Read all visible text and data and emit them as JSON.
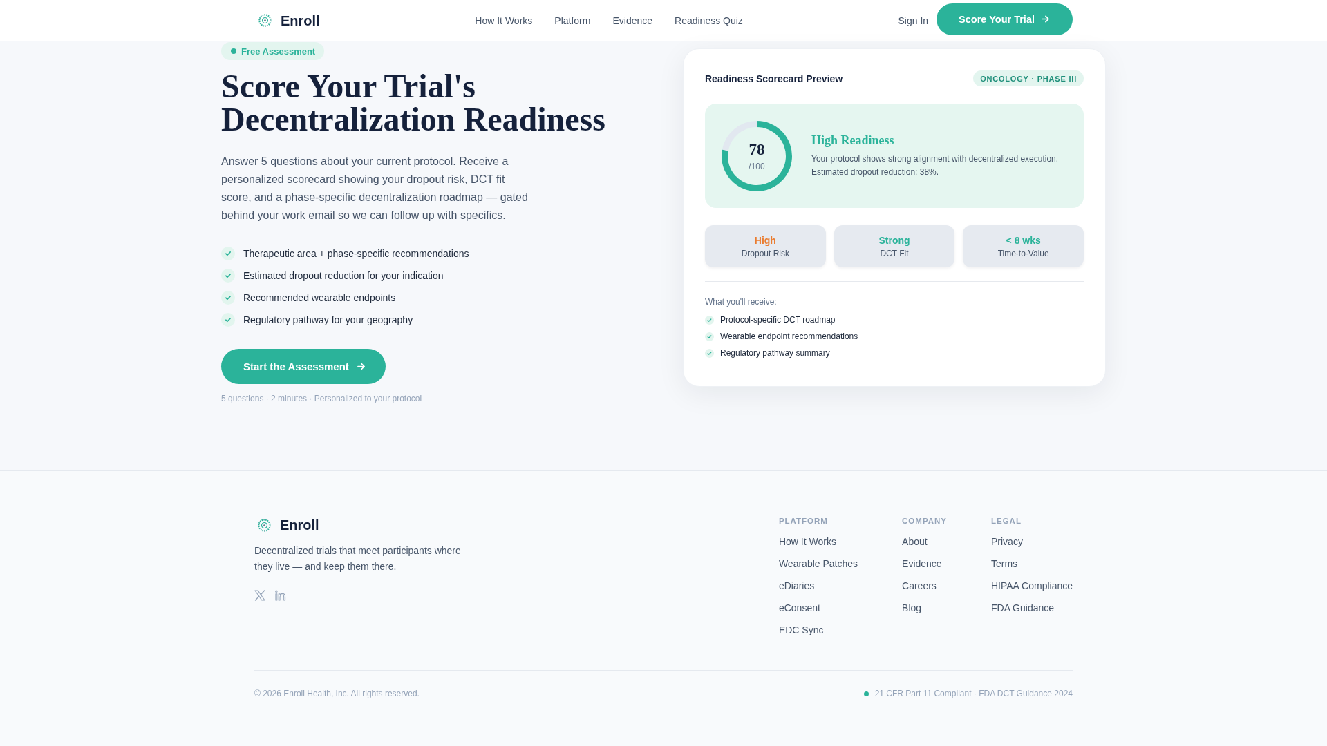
{
  "header": {
    "brand": "Enroll",
    "nav": [
      "How It Works",
      "Platform",
      "Evidence",
      "Readiness Quiz"
    ],
    "sign_in": "Sign In",
    "cta": "Score Your Trial"
  },
  "hero": {
    "badge": "Free Assessment",
    "title": "Score Your Trial's Decentralization Readiness",
    "description": "Answer 5 questions about your current protocol. Receive a personalized scorecard showing your dropout risk, DCT fit score, and a phase-specific decentralization roadmap — gated behind your work email so we can follow up with specifics.",
    "features": [
      "Therapeutic area + phase-specific recommendations",
      "Estimated dropout reduction for your indication",
      "Recommended wearable endpoints",
      "Regulatory pathway for your geography"
    ],
    "button": "Start the Assessment",
    "note": "5 questions · 2 minutes · Personalized to your protocol"
  },
  "scorecard": {
    "title": "Readiness Scorecard Preview",
    "tag": "ONCOLOGY · PHASE III",
    "score": {
      "value": "78",
      "max": "/100",
      "chart_data": {
        "type": "donut",
        "values": [
          78,
          22
        ],
        "colors": [
          "#2bb39a",
          "#e2e8f0"
        ]
      }
    },
    "headline": "High Readiness",
    "summary": "Your protocol shows strong alignment with decentralized execution. Estimated dropout reduction: 38%.",
    "stats": [
      {
        "value": "High",
        "label": "Dropout Risk",
        "color": "#ea7c2f"
      },
      {
        "value": "Strong",
        "label": "DCT Fit",
        "color": "#2bb39a"
      },
      {
        "value": "< 8 wks",
        "label": "Time-to-Value",
        "color": "#2bb39a"
      }
    ],
    "receive_title": "What you'll receive:",
    "receive_items": [
      "Protocol-specific DCT roadmap",
      "Wearable endpoint recommendations",
      "Regulatory pathway summary"
    ]
  },
  "footer": {
    "brand": "Enroll",
    "tagline": "Decentralized trials that meet participants where they live — and keep them there.",
    "columns": [
      {
        "heading": "PLATFORM",
        "links": [
          "How It Works",
          "Wearable Patches",
          "eDiaries",
          "eConsent",
          "EDC Sync"
        ]
      },
      {
        "heading": "COMPANY",
        "links": [
          "About",
          "Evidence",
          "Careers",
          "Blog"
        ]
      },
      {
        "heading": "LEGAL",
        "links": [
          "Privacy",
          "Terms",
          "HIPAA Compliance",
          "FDA Guidance"
        ]
      }
    ],
    "copyright": "© 2026 Enroll Health, Inc. All rights reserved.",
    "compliance": "21 CFR Part 11 Compliant · FDA DCT Guidance 2024"
  }
}
